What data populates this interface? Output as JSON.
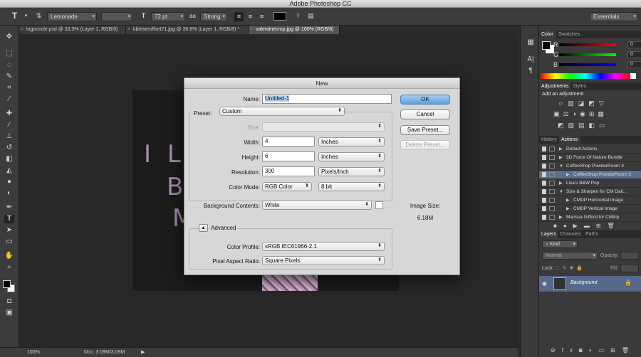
{
  "window": {
    "title": "Adobe Photoshop CC"
  },
  "options_bar": {
    "tool_icon": "T",
    "font_family": "Lemonade",
    "font_style": "",
    "font_size": "72 pt",
    "aa_icon": "a",
    "aa_label": "aa",
    "antialias": "Strong",
    "workspace": "Essentials"
  },
  "tabs": [
    {
      "label": "logocircle.psd @ 33.3% (Layer 1, RGB/8)"
    },
    {
      "label": "kbieseroffset71.jpg @ 36.8% (Layer 1, RGB/8) *"
    },
    {
      "label": "valentinecrop.jpg @ 100% (RGB/8)"
    }
  ],
  "canvas": {
    "text_lines": [
      "I LIV",
      "BE",
      "M"
    ]
  },
  "status": {
    "zoom": "100%",
    "doc": "Doc: 3.09M/3.09M"
  },
  "color_panel": {
    "tabs": [
      "Color",
      "Swatches"
    ],
    "channels": [
      {
        "label": "R",
        "value": "0"
      },
      {
        "label": "G",
        "value": "0"
      },
      {
        "label": "B",
        "value": "0"
      }
    ]
  },
  "adjustments_panel": {
    "tabs": [
      "Adjustments",
      "Styles"
    ],
    "heading": "Add an adjustment"
  },
  "actions_panel": {
    "tabs": [
      "History",
      "Actions"
    ],
    "rows": [
      "Default Actions",
      "3D Force Of Nature Bundle",
      "CoffeeShop PowderRoom 3",
      "CoffeeShop PowderRoom 3",
      "Lisa's B&W Pop",
      "Size & Sharpen for CM Dail...",
      "CMDP Horizontal Image",
      "CMDP Vertical Image",
      "Marissa Gifford for CMtrip"
    ]
  },
  "layers_panel": {
    "tabs": [
      "Layers",
      "Channels",
      "Paths"
    ],
    "kind": "Kind",
    "blend": "Normal",
    "opacity_label": "Opacity:",
    "lock_label": "Lock:",
    "fill_label": "Fill:",
    "layer_name": "Background"
  },
  "dialog": {
    "title": "New",
    "name_label": "Name:",
    "name_value": "Untitled-1",
    "preset_label": "Preset:",
    "preset_value": "Custom",
    "size_label": "Size:",
    "width_label": "Width:",
    "width_value": "4",
    "width_unit": "Inches",
    "height_label": "Height:",
    "height_value": "6",
    "height_unit": "Inches",
    "resolution_label": "Resolution:",
    "resolution_value": "300",
    "resolution_unit": "Pixels/Inch",
    "color_mode_label": "Color Mode:",
    "color_mode_value": "RGB Color",
    "bit_depth": "8 bit",
    "bg_label": "Background Contents:",
    "bg_value": "White",
    "advanced_label": "Advanced",
    "profile_label": "Color Profile:",
    "profile_value": "sRGB IEC61966-2.1",
    "aspect_label": "Pixel Aspect Ratio:",
    "aspect_value": "Square Pixels",
    "ok": "OK",
    "cancel": "Cancel",
    "save_preset": "Save Preset...",
    "delete_preset": "Delete Preset...",
    "image_size_label": "Image Size:",
    "image_size_value": "6.18M"
  }
}
